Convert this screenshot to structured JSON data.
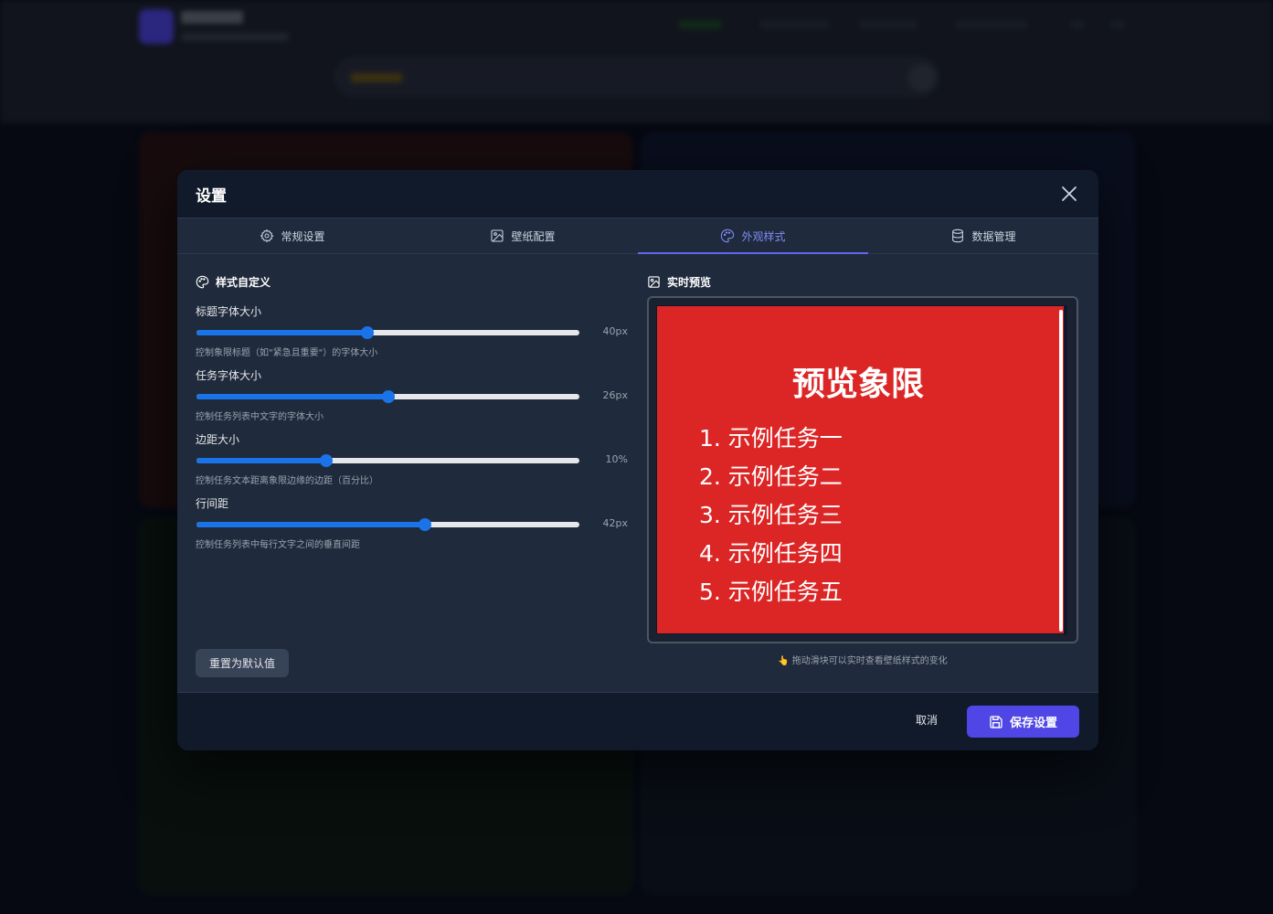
{
  "modal": {
    "title": "设置",
    "close_icon": "close-icon"
  },
  "tabs": [
    {
      "label": "常规设置",
      "icon": "gear-icon",
      "active": false
    },
    {
      "label": "壁纸配置",
      "icon": "image-icon",
      "active": false
    },
    {
      "label": "外观样式",
      "icon": "palette-icon",
      "active": true
    },
    {
      "label": "数据管理",
      "icon": "database-icon",
      "active": false
    }
  ],
  "style_section": {
    "title": "样式自定义",
    "controls": [
      {
        "label": "标题字体大小",
        "value_text": "40px",
        "fraction": 0.447,
        "hint": "控制象限标题（如\"紧急且重要\"）的字体大小"
      },
      {
        "label": "任务字体大小",
        "value_text": "26px",
        "fraction": 0.501,
        "hint": "控制任务列表中文字的字体大小"
      },
      {
        "label": "边距大小",
        "value_text": "10%",
        "fraction": 0.339,
        "hint": "控制任务文本距离象限边缘的边距（百分比）"
      },
      {
        "label": "行间距",
        "value_text": "42px",
        "fraction": 0.597,
        "hint": "控制任务列表中每行文字之间的垂直间距"
      }
    ],
    "reset_label": "重置为默认值"
  },
  "preview": {
    "title": "实时预览",
    "quadrant_title": "预览象限",
    "bg_color": "#dc2626",
    "tasks": [
      "1. 示例任务一",
      "2. 示例任务二",
      "3. 示例任务三",
      "4. 示例任务四",
      "5. 示例任务五"
    ],
    "tip": "👆 拖动滑块可以实时查看壁纸样式的变化"
  },
  "footer": {
    "cancel_label": "取消",
    "save_label": "保存设置"
  },
  "colors": {
    "accent": "#4f46e5",
    "slider": "#1a73e8",
    "active_tab": "#818cf8"
  }
}
